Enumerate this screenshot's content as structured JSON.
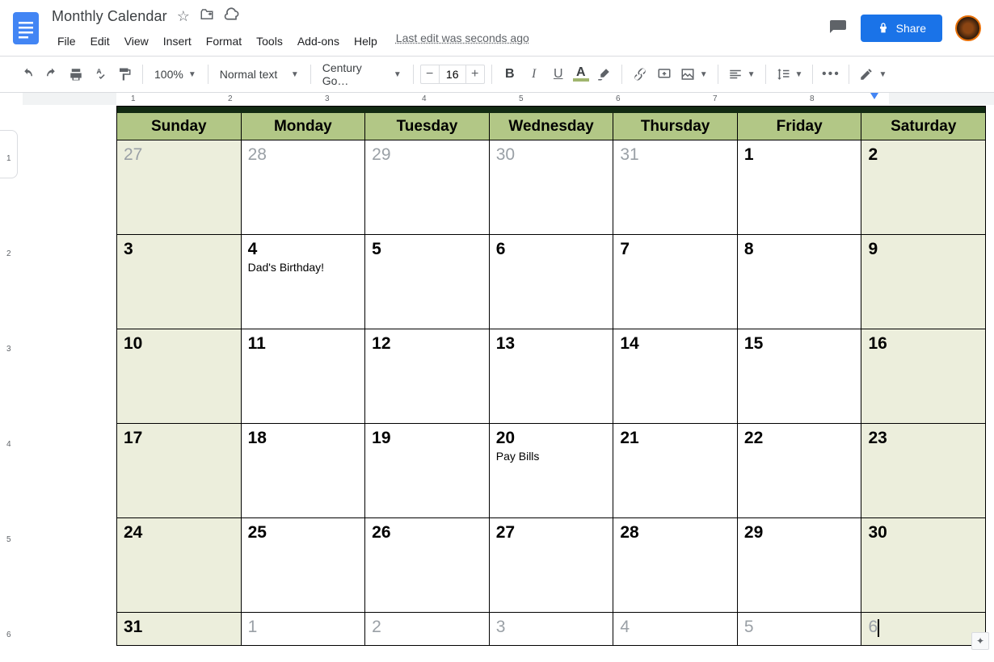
{
  "doc": {
    "title": "Monthly Calendar"
  },
  "menu": {
    "items": [
      "File",
      "Edit",
      "View",
      "Insert",
      "Format",
      "Tools",
      "Add-ons",
      "Help"
    ],
    "last_edit": "Last edit was seconds ago"
  },
  "header": {
    "share_label": "Share"
  },
  "toolbar": {
    "zoom": "100%",
    "style": "Normal text",
    "font": "Century Go…",
    "font_size": "16"
  },
  "calendar": {
    "days": [
      "Sunday",
      "Monday",
      "Tuesday",
      "Wednesday",
      "Thursday",
      "Friday",
      "Saturday"
    ],
    "rows": [
      [
        {
          "n": "27",
          "other": true,
          "weekend": true
        },
        {
          "n": "28",
          "other": true
        },
        {
          "n": "29",
          "other": true
        },
        {
          "n": "30",
          "other": true
        },
        {
          "n": "31",
          "other": true
        },
        {
          "n": "1"
        },
        {
          "n": "2",
          "weekend": true
        }
      ],
      [
        {
          "n": "3",
          "weekend": true
        },
        {
          "n": "4",
          "note": "Dad's Birthday!"
        },
        {
          "n": "5"
        },
        {
          "n": "6"
        },
        {
          "n": "7"
        },
        {
          "n": "8"
        },
        {
          "n": "9",
          "weekend": true
        }
      ],
      [
        {
          "n": "10",
          "weekend": true
        },
        {
          "n": "11"
        },
        {
          "n": "12"
        },
        {
          "n": "13"
        },
        {
          "n": "14"
        },
        {
          "n": "15"
        },
        {
          "n": "16",
          "weekend": true
        }
      ],
      [
        {
          "n": "17",
          "weekend": true
        },
        {
          "n": "18"
        },
        {
          "n": "19"
        },
        {
          "n": "20",
          "note": "Pay Bills"
        },
        {
          "n": "21"
        },
        {
          "n": "22"
        },
        {
          "n": "23",
          "weekend": true
        }
      ],
      [
        {
          "n": "24",
          "weekend": true
        },
        {
          "n": "25"
        },
        {
          "n": "26"
        },
        {
          "n": "27"
        },
        {
          "n": "28"
        },
        {
          "n": "29"
        },
        {
          "n": "30",
          "weekend": true
        }
      ],
      [
        {
          "n": "31",
          "weekend": true
        },
        {
          "n": "1",
          "other": true
        },
        {
          "n": "2",
          "other": true
        },
        {
          "n": "3",
          "other": true
        },
        {
          "n": "4",
          "other": true
        },
        {
          "n": "5",
          "other": true
        },
        {
          "n": "6",
          "other": true,
          "weekend": true,
          "cursor": true
        }
      ]
    ]
  },
  "ruler": {
    "h": [
      "1",
      "2",
      "3",
      "4",
      "5",
      "6",
      "7",
      "8"
    ],
    "v": [
      "1",
      "2",
      "3",
      "4",
      "5",
      "6"
    ]
  }
}
